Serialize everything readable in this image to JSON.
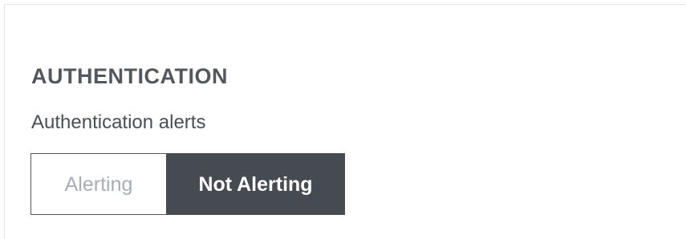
{
  "section": {
    "title": "AUTHENTICATION",
    "field_label": "Authentication alerts"
  },
  "toggle": {
    "options": [
      {
        "label": "Alerting",
        "selected": false
      },
      {
        "label": "Not Alerting",
        "selected": true
      }
    ]
  },
  "colors": {
    "active_bg": "#464a51",
    "active_text": "#ffffff",
    "inactive_text": "#a9adb5",
    "title_text": "#54575d"
  }
}
